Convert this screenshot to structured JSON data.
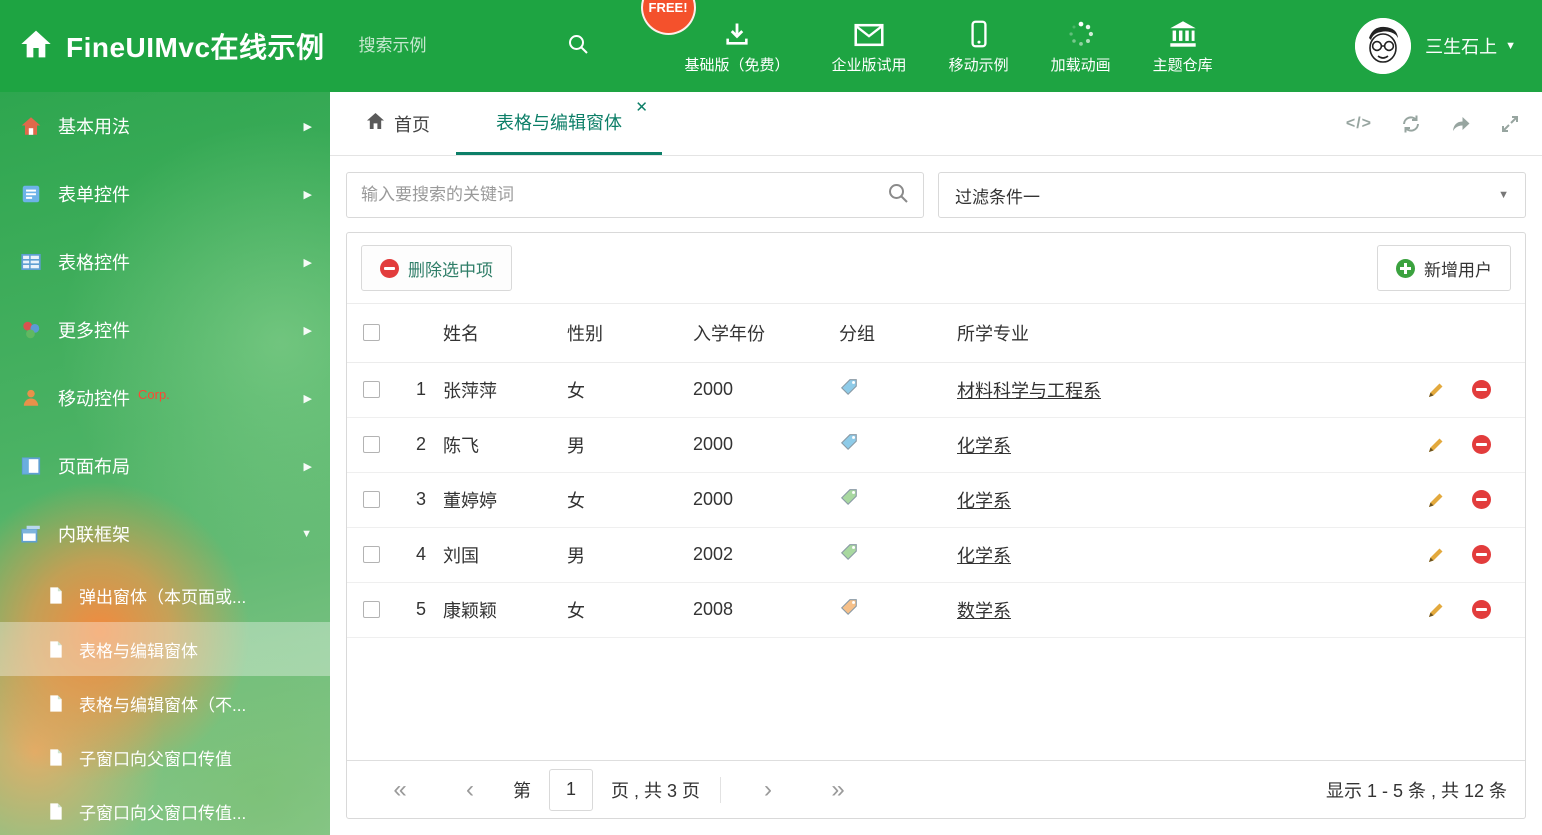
{
  "colors": {
    "header_green": "#1ea442",
    "accent_teal": "#0d7f68",
    "danger_red": "#e23c3c",
    "add_green": "#3ba23f",
    "free_badge_bg": "#f4512c"
  },
  "header": {
    "app_title": "FineUIMvc在线示例",
    "search_placeholder": "搜索示例",
    "free_badge": "FREE!",
    "nav_items": [
      {
        "label": "基础版（免费）",
        "icon": "download-icon"
      },
      {
        "label": "企业版试用",
        "icon": "mail-icon"
      },
      {
        "label": "移动示例",
        "icon": "mobile-icon"
      },
      {
        "label": "加载动画",
        "icon": "spinner-icon"
      },
      {
        "label": "主题仓库",
        "icon": "bank-icon"
      }
    ],
    "username": "三生石上"
  },
  "sidebar": {
    "items": [
      {
        "label": "基本用法"
      },
      {
        "label": "表单控件"
      },
      {
        "label": "表格控件"
      },
      {
        "label": "更多控件"
      },
      {
        "label": "移动控件",
        "badge": "Corp."
      },
      {
        "label": "页面布局"
      },
      {
        "label": "内联框架"
      }
    ],
    "subitems": [
      {
        "label": "弹出窗体（本页面或..."
      },
      {
        "label": "表格与编辑窗体",
        "selected": true
      },
      {
        "label": "表格与编辑窗体（不..."
      },
      {
        "label": "子窗口向父窗口传值"
      },
      {
        "label": "子窗口向父窗口传值..."
      }
    ]
  },
  "tabs": {
    "home_label": "首页",
    "active_label": "表格与编辑窗体"
  },
  "content": {
    "search_placeholder": "输入要搜索的关键词",
    "filter_selected": "过滤条件一",
    "toolbar": {
      "delete_label": "删除选中项",
      "add_label": "新增用户"
    },
    "table": {
      "columns": [
        "姓名",
        "性别",
        "入学年份",
        "分组",
        "所学专业"
      ],
      "rows": [
        {
          "index": "1",
          "name": "张萍萍",
          "gender": "女",
          "year": "2000",
          "tag_color": "#8ecbe8",
          "major": "材料科学与工程系"
        },
        {
          "index": "2",
          "name": "陈飞",
          "gender": "男",
          "year": "2000",
          "tag_color": "#8ecbe8",
          "major": "化学系"
        },
        {
          "index": "3",
          "name": "董婷婷",
          "gender": "女",
          "year": "2000",
          "tag_color": "#a8d8a0",
          "major": "化学系"
        },
        {
          "index": "4",
          "name": "刘国",
          "gender": "男",
          "year": "2002",
          "tag_color": "#a8d8a0",
          "major": "化学系"
        },
        {
          "index": "5",
          "name": "康颖颖",
          "gender": "女",
          "year": "2008",
          "tag_color": "#f6c089",
          "major": "数学系"
        }
      ]
    },
    "pagination": {
      "page_prefix": "第",
      "page_value": "1",
      "page_suffix": "页 , 共 3 页",
      "summary": "显示 1 - 5 条 , 共 12 条"
    }
  }
}
